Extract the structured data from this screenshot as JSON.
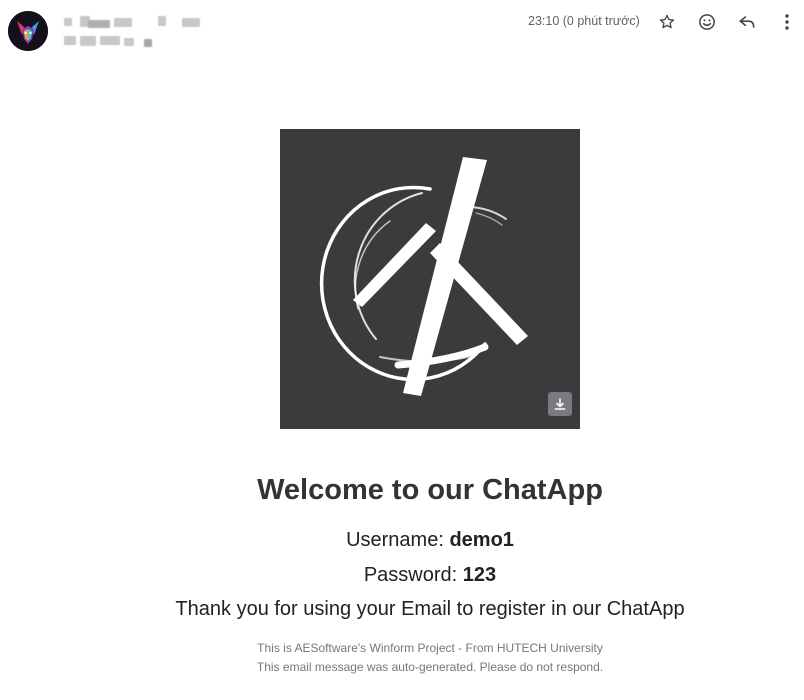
{
  "header": {
    "timestamp": "23:10 (0 phút trước)",
    "icons": {
      "star": "star-icon",
      "emoji": "emoji-icon",
      "reply": "reply-icon",
      "more": "more-vert-icon"
    }
  },
  "email": {
    "welcome_title": "Welcome to our ChatApp",
    "username_label": "Username: ",
    "username_value": "demo1",
    "password_label": "Password: ",
    "password_value": "123",
    "thanks_text": "Thank you for using your Email to register in our ChatApp",
    "footer_line1": "This is AESoftware's Winform Project - From HUTECH University",
    "footer_line2": "This email message was auto-generated. Please do not respond."
  },
  "colors": {
    "image_background": "#3a3b3d",
    "heading": "#333333",
    "footer": "#777777"
  }
}
